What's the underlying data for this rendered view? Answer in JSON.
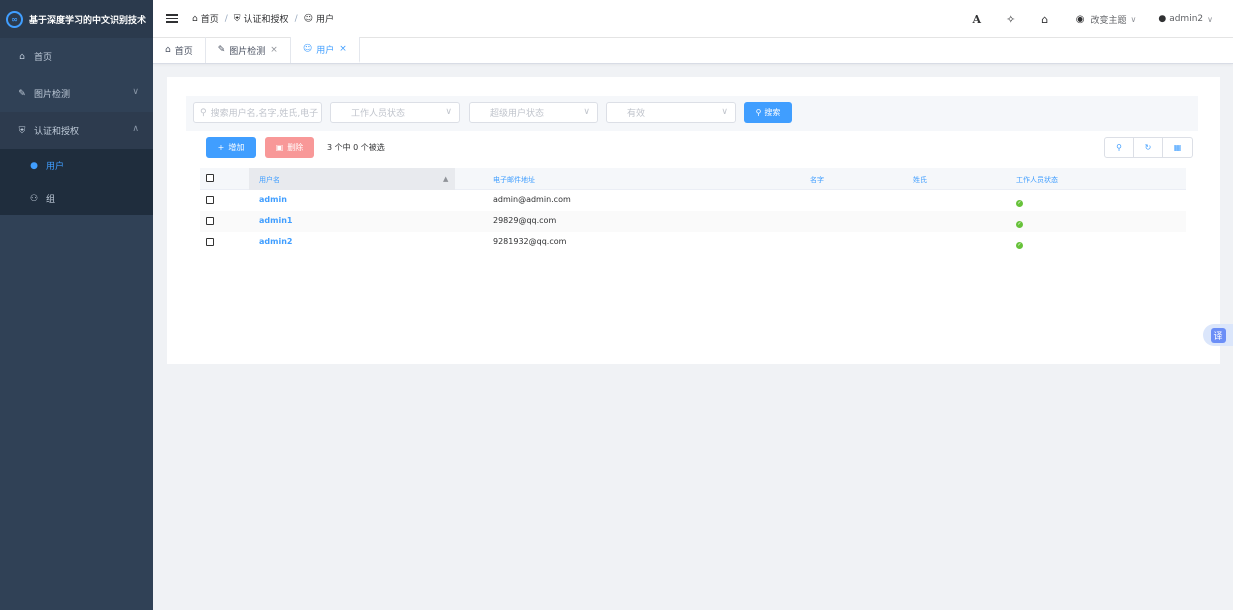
{
  "app": {
    "title": "基于深度学习的中文识别技术",
    "logo_glyph": "∞"
  },
  "sidebar": {
    "items": [
      {
        "label": "首页",
        "icon": "home-icon"
      },
      {
        "label": "图片检测",
        "icon": "pencil-icon",
        "chevron": "∨"
      },
      {
        "label": "认证和授权",
        "icon": "shield-icon",
        "chevron": "∧"
      }
    ],
    "submenu": [
      {
        "label": "用户",
        "icon": "user-icon",
        "active": true
      },
      {
        "label": "组",
        "icon": "group-icon"
      }
    ]
  },
  "header": {
    "breadcrumb": [
      "首页",
      "认证和授权",
      "用户"
    ],
    "breadcrumb_sep": "/",
    "theme_label": "改变主题",
    "user_label": "admin2"
  },
  "tags": [
    {
      "label": "首页"
    },
    {
      "label": "图片检测",
      "close": "×"
    },
    {
      "label": "用户",
      "close": "×",
      "active": true
    }
  ],
  "filters": {
    "search_placeholder": "搜索用户名,名字,姓氏,电子",
    "staff_status_placeholder": "工作人员状态",
    "superuser_status_placeholder": "超级用户状态",
    "active_placeholder": "有效",
    "search_button": "搜索"
  },
  "toolbar": {
    "add_label": "增加",
    "delete_label": "删除",
    "selection_text": "3 个中 0 个被选"
  },
  "table": {
    "columns": [
      "用户名",
      "电子邮件地址",
      "名字",
      "姓氏",
      "工作人员状态"
    ],
    "sort_indicator": "▲",
    "rows": [
      {
        "username": "admin",
        "email": "admin@admin.com",
        "first_name": "",
        "last_name": "",
        "staff": true
      },
      {
        "username": "admin1",
        "email": "29829@qq.com",
        "first_name": "",
        "last_name": "",
        "staff": true
      },
      {
        "username": "admin2",
        "email": "9281932@qq.com",
        "first_name": "",
        "last_name": "",
        "staff": true
      }
    ]
  },
  "translate_badge": "译",
  "colors": {
    "primary": "#409eff",
    "danger_light": "#f89898",
    "sidebar": "#304156",
    "success": "#67c23a"
  }
}
